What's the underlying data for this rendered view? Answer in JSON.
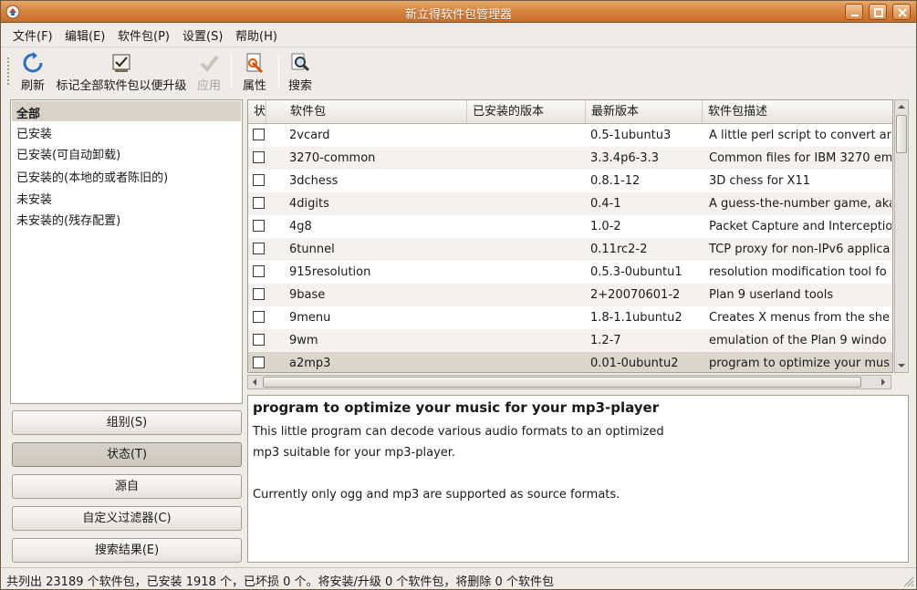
{
  "window": {
    "title": "新立得软件包管理器"
  },
  "menu": [
    "文件(F)",
    "编辑(E)",
    "软件包(P)",
    "设置(S)",
    "帮助(H)"
  ],
  "toolbar": {
    "refresh": "刷新",
    "mark_upgrades": "标记全部软件包以便升级",
    "apply": "应用",
    "properties": "属性",
    "search": "搜索"
  },
  "filters": {
    "items": [
      "全部",
      "已安装",
      "已安装(可自动卸载)",
      "已安装的(本地的或者陈旧的)",
      "未安装",
      "未安装的(残存配置)"
    ],
    "selected_index": 0
  },
  "left_buttons": {
    "sections": "组别(S)",
    "status": "状态(T)",
    "origin": "源自",
    "custom_filters": "自定义过滤器(C)",
    "search_results": "搜索结果(E)"
  },
  "table": {
    "columns": {
      "status": "状",
      "package": "软件包",
      "installed_version": "已安装的版本",
      "latest_version": "最新版本",
      "description": "软件包描述"
    },
    "rows": [
      {
        "name": "2vcard",
        "installed": "",
        "latest": "0.5-1ubuntu3",
        "desc": "A little perl script to convert an"
      },
      {
        "name": "3270-common",
        "installed": "",
        "latest": "3.3.4p6-3.3",
        "desc": "Common files for IBM 3270 em"
      },
      {
        "name": "3dchess",
        "installed": "",
        "latest": "0.8.1-12",
        "desc": "3D chess for X11"
      },
      {
        "name": "4digits",
        "installed": "",
        "latest": "0.4-1",
        "desc": "A guess-the-number game, aka"
      },
      {
        "name": "4g8",
        "installed": "",
        "latest": "1.0-2",
        "desc": "Packet Capture and Interceptio"
      },
      {
        "name": "6tunnel",
        "installed": "",
        "latest": "0.11rc2-2",
        "desc": "TCP proxy for non-IPv6 applica"
      },
      {
        "name": "915resolution",
        "installed": "",
        "latest": "0.5.3-0ubuntu1",
        "desc": "resolution modification tool fo"
      },
      {
        "name": "9base",
        "installed": "",
        "latest": "2+20070601-2",
        "desc": "Plan 9 userland tools"
      },
      {
        "name": "9menu",
        "installed": "",
        "latest": "1.8-1.1ubuntu2",
        "desc": "Creates X menus from the she"
      },
      {
        "name": "9wm",
        "installed": "",
        "latest": "1.2-7",
        "desc": "emulation of the Plan 9 windo"
      },
      {
        "name": "a2mp3",
        "installed": "",
        "latest": "0.01-0ubuntu2",
        "desc": "program to optimize your mus"
      }
    ],
    "selected_row": 10
  },
  "description": {
    "title": "program to optimize your music for your mp3-player",
    "lines": [
      "This little program can decode various audio formats to an optimized",
      "mp3 suitable for your mp3-player.",
      "",
      "Currently only ogg and mp3 are supported as source formats."
    ]
  },
  "status": "共列出 23189 个软件包，已安装 1918 个，已坏损 0 个。将安装/升级 0 个软件包，将删除 0 个软件包",
  "colors": {
    "titlebar": "#d9853f",
    "selection": "#dcd5cb",
    "background": "#efebe7"
  }
}
